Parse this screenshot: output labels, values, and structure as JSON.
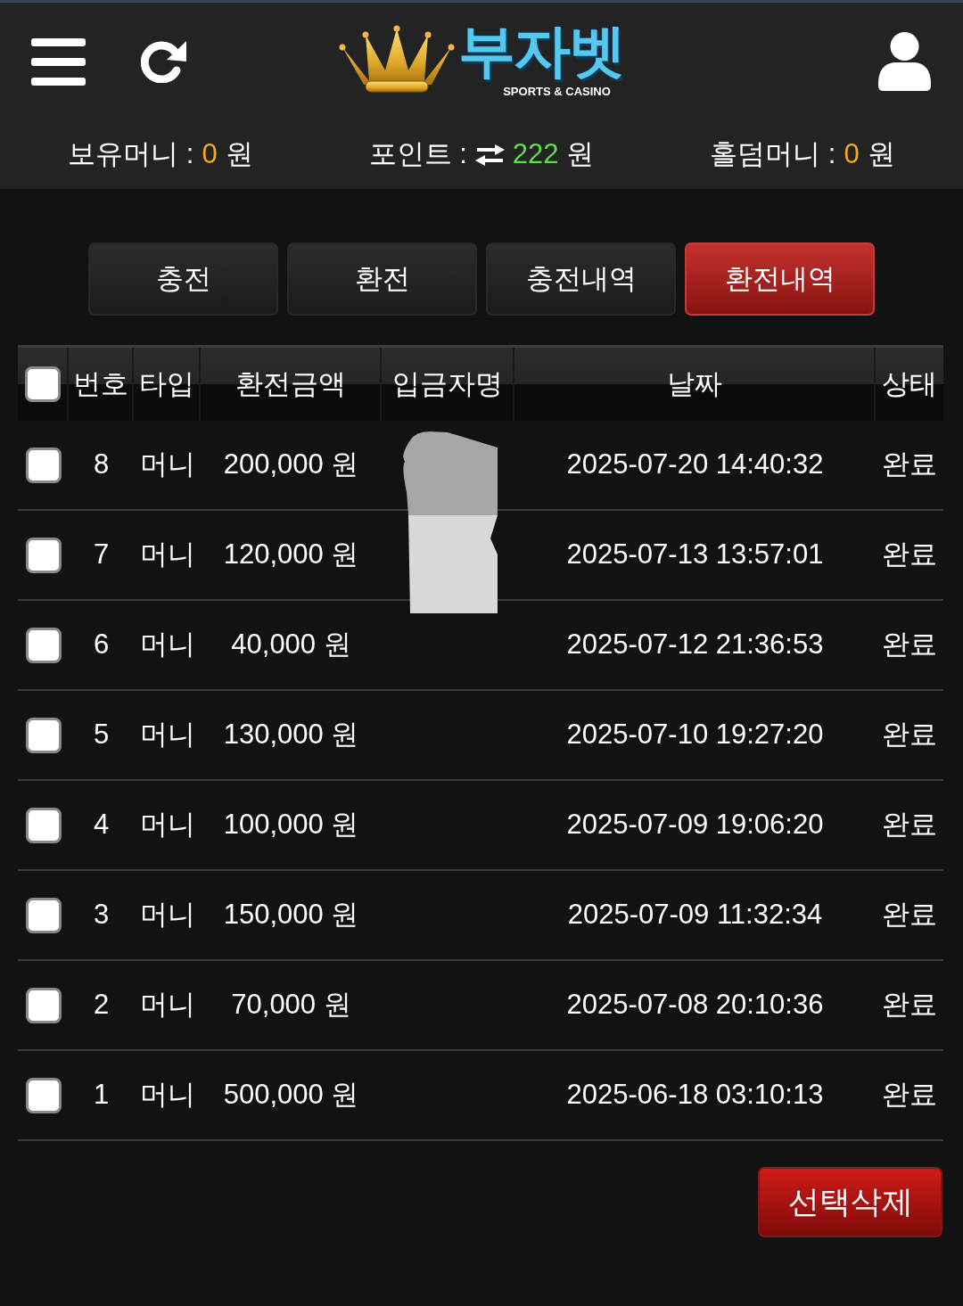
{
  "header": {
    "logo": {
      "title": "부자벳",
      "tagline": "SPORTS & CASINO"
    }
  },
  "balances": [
    {
      "kind": "money",
      "label": "보유머니 :",
      "value": "0",
      "unit": "원",
      "color": "#f5a623"
    },
    {
      "kind": "point",
      "label": "포인트 :",
      "value": "222",
      "unit": "원",
      "color": "#5fdc4c"
    },
    {
      "kind": "money",
      "label": "홀덤머니 :",
      "value": "0",
      "unit": "원",
      "color": "#f5a623"
    }
  ],
  "tabs": [
    {
      "label": "충전",
      "selected": false
    },
    {
      "label": "환전",
      "selected": false
    },
    {
      "label": "충전내역",
      "selected": false
    },
    {
      "label": "환전내역",
      "selected": true
    }
  ],
  "table": {
    "select_all": {
      "checked": false
    },
    "columns": [
      "번호",
      "타입",
      "환전금액",
      "입금자명",
      "날짜",
      "상태"
    ],
    "rows": [
      {
        "checked": false,
        "number": "8",
        "type": "머니",
        "amount": "200,000 원",
        "date": "2025-07-20 14:40:32",
        "status": "완료"
      },
      {
        "checked": false,
        "number": "7",
        "type": "머니",
        "amount": "120,000 원",
        "date": "2025-07-13 13:57:01",
        "status": "완료"
      },
      {
        "checked": false,
        "number": "6",
        "type": "머니",
        "amount": "40,000 원",
        "date": "2025-07-12 21:36:53",
        "status": "완료"
      },
      {
        "checked": false,
        "number": "5",
        "type": "머니",
        "amount": "130,000 원",
        "date": "2025-07-10 19:27:20",
        "status": "완료"
      },
      {
        "checked": false,
        "number": "4",
        "type": "머니",
        "amount": "100,000 원",
        "date": "2025-07-09 19:06:20",
        "status": "완료"
      },
      {
        "checked": false,
        "number": "3",
        "type": "머니",
        "amount": "150,000 원",
        "date": "2025-07-09 11:32:34",
        "status": "완료"
      },
      {
        "checked": false,
        "number": "2",
        "type": "머니",
        "amount": "70,000 원",
        "date": "2025-07-08 20:10:36",
        "status": "완료"
      },
      {
        "checked": false,
        "number": "1",
        "type": "머니",
        "amount": "500,000 원",
        "date": "2025-06-18 03:10:13",
        "status": "완료"
      }
    ]
  },
  "delete_button": "선택삭제"
}
